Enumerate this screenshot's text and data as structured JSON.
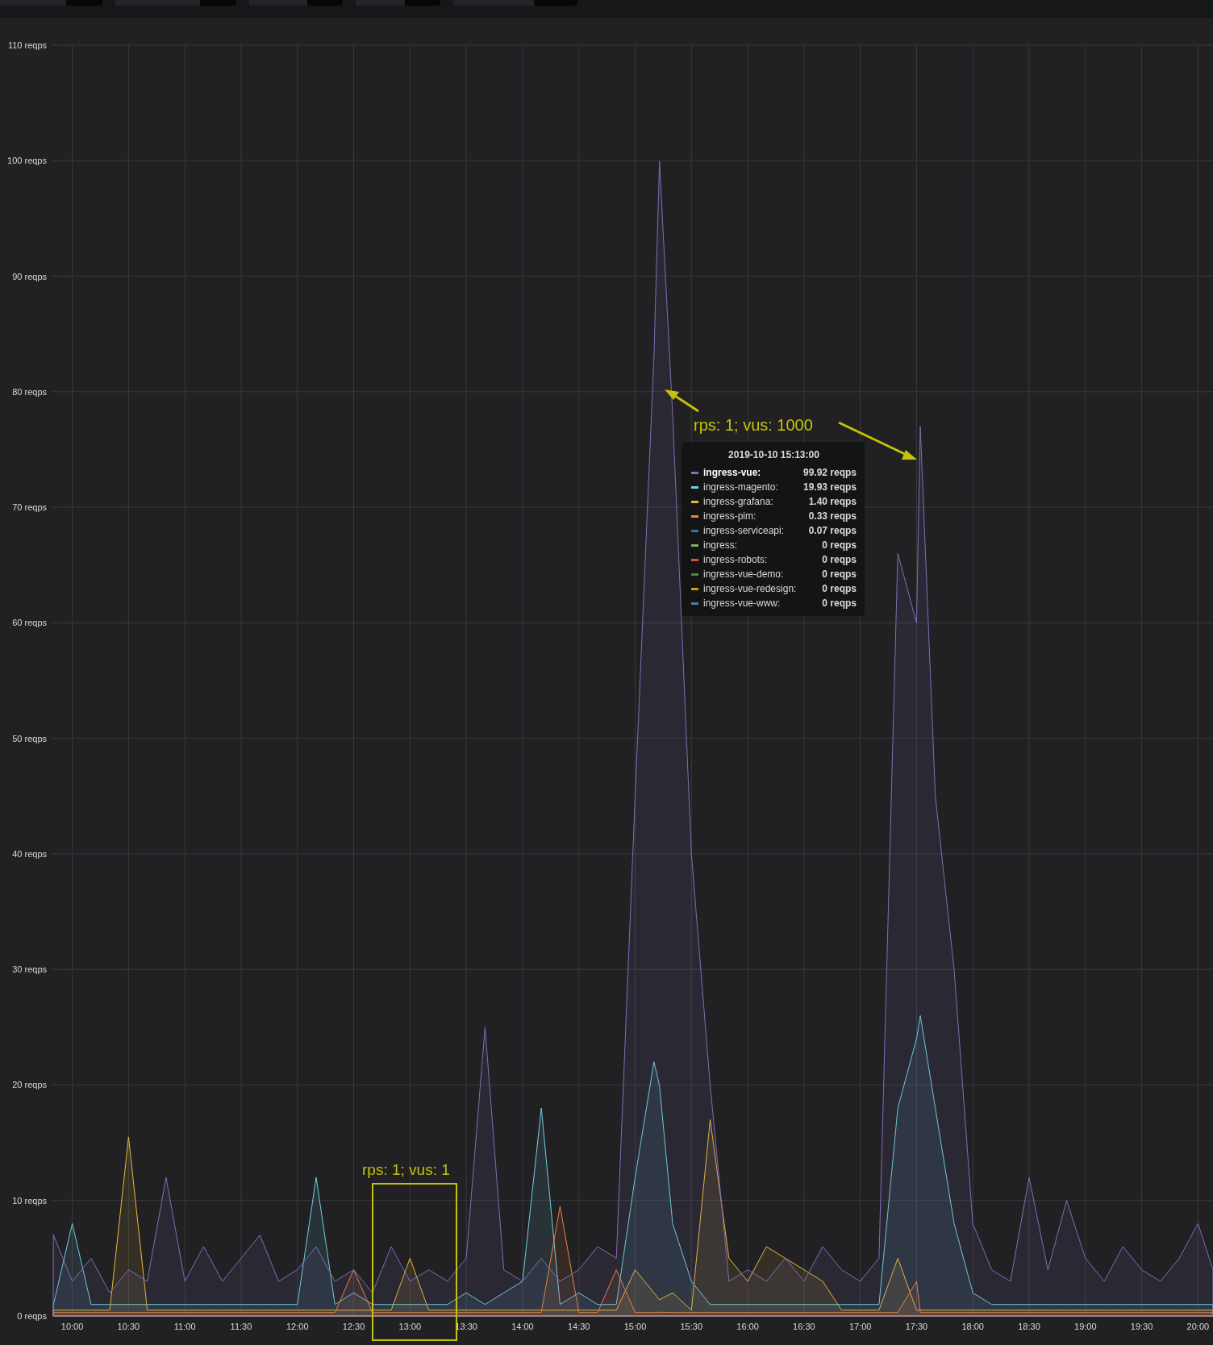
{
  "toolbar": {
    "controls": [
      {
        "kind": "dropdown"
      },
      {
        "kind": "dropdown"
      },
      {
        "kind": "dropdown"
      },
      {
        "kind": "dropdown"
      },
      {
        "kind": "dropdown"
      }
    ]
  },
  "chart_data": {
    "type": "area",
    "xlim": [
      589,
      1208
    ],
    "ylim": [
      0,
      110
    ],
    "x": [
      590,
      600,
      610,
      620,
      630,
      640,
      650,
      660,
      670,
      680,
      690,
      700,
      710,
      720,
      730,
      740,
      750,
      760,
      770,
      780,
      790,
      800,
      810,
      820,
      830,
      840,
      850,
      860,
      870,
      880,
      890,
      900,
      910,
      913,
      920,
      930,
      940,
      950,
      960,
      970,
      980,
      990,
      1000,
      1010,
      1020,
      1030,
      1040,
      1050,
      1052,
      1060,
      1070,
      1080,
      1090,
      1100,
      1110,
      1120,
      1130,
      1140,
      1150,
      1160,
      1170,
      1180,
      1190,
      1200,
      1208
    ],
    "yticks": [
      {
        "value": 0,
        "label": "0 reqps"
      },
      {
        "value": 10,
        "label": "10 reqps"
      },
      {
        "value": 20,
        "label": "20 reqps"
      },
      {
        "value": 30,
        "label": "30 reqps"
      },
      {
        "value": 40,
        "label": "40 reqps"
      },
      {
        "value": 50,
        "label": "50 reqps"
      },
      {
        "value": 60,
        "label": "60 reqps"
      },
      {
        "value": 70,
        "label": "70 reqps"
      },
      {
        "value": 80,
        "label": "80 reqps"
      },
      {
        "value": 90,
        "label": "90 reqps"
      },
      {
        "value": 100,
        "label": "100 reqps"
      },
      {
        "value": 110,
        "label": "110 reqps"
      }
    ],
    "xticks": [
      {
        "value": 600,
        "label": "10:00"
      },
      {
        "value": 630,
        "label": "10:30"
      },
      {
        "value": 660,
        "label": "11:00"
      },
      {
        "value": 690,
        "label": "11:30"
      },
      {
        "value": 720,
        "label": "12:00"
      },
      {
        "value": 750,
        "label": "12:30"
      },
      {
        "value": 780,
        "label": "13:00"
      },
      {
        "value": 810,
        "label": "13:30"
      },
      {
        "value": 840,
        "label": "14:00"
      },
      {
        "value": 870,
        "label": "14:30"
      },
      {
        "value": 900,
        "label": "15:00"
      },
      {
        "value": 930,
        "label": "15:30"
      },
      {
        "value": 960,
        "label": "16:00"
      },
      {
        "value": 990,
        "label": "16:30"
      },
      {
        "value": 1020,
        "label": "17:00"
      },
      {
        "value": 1050,
        "label": "17:30"
      },
      {
        "value": 1080,
        "label": "18:00"
      },
      {
        "value": 1110,
        "label": "18:30"
      },
      {
        "value": 1140,
        "label": "19:00"
      },
      {
        "value": 1170,
        "label": "19:30"
      },
      {
        "value": 1200,
        "label": "20:00"
      }
    ],
    "series": [
      {
        "color": "#6ed0e0",
        "values": [
          1,
          8,
          1,
          1,
          1,
          1,
          1,
          1,
          1,
          1,
          1,
          1,
          1,
          1,
          12,
          1,
          2,
          1,
          1,
          1,
          1,
          1,
          2,
          1,
          2,
          3,
          18,
          1,
          2,
          1,
          1,
          12,
          22,
          19.93,
          8,
          3,
          1,
          1,
          1,
          1,
          1,
          1,
          1,
          1,
          1,
          1,
          18,
          24,
          26,
          18,
          8,
          2,
          1,
          1,
          1,
          1,
          1,
          1,
          1,
          1,
          1,
          1,
          1,
          1,
          1
        ]
      },
      {
        "color": "#eab839",
        "values": [
          0.5,
          0.5,
          0.5,
          0.5,
          15.5,
          0.5,
          0.5,
          0.5,
          0.5,
          0.5,
          0.5,
          0.5,
          0.5,
          0.5,
          0.5,
          0.5,
          0.5,
          0.5,
          0.5,
          5,
          0.5,
          0.5,
          0.5,
          0.5,
          0.5,
          0.5,
          0.5,
          0.5,
          0.5,
          0.5,
          0.5,
          4,
          2,
          1.4,
          2,
          0.5,
          17,
          5,
          3,
          6,
          5,
          4,
          3,
          0.5,
          0.5,
          0.5,
          5,
          0.5,
          0.5,
          0.5,
          0.5,
          0.5,
          0.5,
          0.5,
          0.5,
          0.5,
          0.5,
          0.5,
          0.5,
          0.5,
          0.5,
          0.5,
          0.5,
          0.5,
          0.5
        ]
      },
      {
        "color": "#ef843c",
        "values": [
          0.3,
          0.3,
          0.3,
          0.3,
          0.3,
          0.3,
          0.3,
          0.3,
          0.3,
          0.3,
          0.3,
          0.3,
          0.3,
          0.3,
          0.3,
          0.3,
          4,
          0.3,
          0.3,
          0.3,
          0.3,
          0.3,
          0.3,
          0.3,
          0.3,
          0.3,
          0.3,
          9.5,
          0.3,
          0.3,
          4,
          0.3,
          0.3,
          0.33,
          0.3,
          0.3,
          0.3,
          0.3,
          0.3,
          0.3,
          0.3,
          0.3,
          0.3,
          0.3,
          0.3,
          0.3,
          0.3,
          3,
          0.3,
          0.3,
          0.3,
          0.3,
          0.3,
          0.3,
          0.3,
          0.3,
          0.3,
          0.3,
          0.3,
          0.3,
          0.3,
          0.3,
          0.3,
          0.3,
          0.3
        ]
      },
      {
        "color": "#806eb7",
        "values": [
          7,
          3,
          5,
          2,
          4,
          3,
          12,
          3,
          6,
          3,
          5,
          7,
          3,
          4,
          6,
          3,
          4,
          2,
          6,
          3,
          4,
          3,
          5,
          25,
          4,
          3,
          5,
          3,
          4,
          6,
          5,
          45,
          83,
          99.92,
          78,
          40,
          20,
          3,
          4,
          3,
          5,
          3,
          6,
          4,
          3,
          5,
          66,
          60,
          77,
          45,
          30,
          8,
          4,
          3,
          12,
          4,
          10,
          5,
          3,
          6,
          4,
          3,
          5,
          8,
          4
        ]
      }
    ],
    "grid": true
  },
  "annotations": [
    {
      "kind": "arrows",
      "text": "rps: 1; vus: 1000"
    },
    {
      "kind": "box",
      "text": "rps: 1; vus: 1"
    }
  ],
  "tooltip": {
    "time": "2019-10-10 15:13:00",
    "rows": [
      {
        "name": "ingress-vue:",
        "value": "99.92 reqps",
        "color": "#806eb7",
        "selected": true
      },
      {
        "name": "ingress-magento:",
        "value": "19.93 reqps",
        "color": "#6ed0e0",
        "selected": false
      },
      {
        "name": "ingress-grafana:",
        "value": "1.40 reqps",
        "color": "#eab839",
        "selected": false
      },
      {
        "name": "ingress-pim:",
        "value": "0.33 reqps",
        "color": "#ef843c",
        "selected": false
      },
      {
        "name": "ingress-serviceapi:",
        "value": "0.07 reqps",
        "color": "#1f78c1",
        "selected": false
      },
      {
        "name": "ingress:",
        "value": "0 reqps",
        "color": "#7eb26d",
        "selected": false
      },
      {
        "name": "ingress-robots:",
        "value": "0 reqps",
        "color": "#e24d42",
        "selected": false
      },
      {
        "name": "ingress-vue-demo:",
        "value": "0 reqps",
        "color": "#508642",
        "selected": false
      },
      {
        "name": "ingress-vue-redesign:",
        "value": "0 reqps",
        "color": "#cca300",
        "selected": false
      },
      {
        "name": "ingress-vue-www:",
        "value": "0 reqps",
        "color": "#447ebc",
        "selected": false
      }
    ]
  }
}
